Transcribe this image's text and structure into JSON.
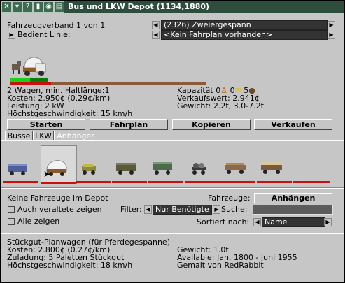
{
  "window": {
    "title": "Bus und LKW Depot (1134,1880)",
    "title_buttons": [
      "close-icon",
      "help-icon",
      "pin-icon",
      "eye-icon",
      "collapse-icon"
    ]
  },
  "convoy": {
    "fahrzeugverband": "Fahrzeugverband 1 von 1",
    "convoy_selected": "(2326) Zweiergespann",
    "bedient_label": "Bedient Linie:",
    "line_selected": "<Kein Fahrplan vorhanden>"
  },
  "stats": {
    "wagen": "2 Wagen, min. Haltlänge:1",
    "kosten": "Kosten:   2.950¢ (0.29¢/km)",
    "leistung": "Leistung:   2 kW",
    "hoechst": "Höchstgeschwindigkeit: 15 km/h",
    "kapazitaet_label": "Kapazität",
    "kapazitaet_values": [
      "0",
      "0",
      "5"
    ],
    "verkaufswert": "Verkaufswert:   2.941¢",
    "gewicht": "Gewicht: 2.2t, 3.0-7.2t"
  },
  "actions": {
    "starten": "Starten",
    "fahrplan": "Fahrplan",
    "kopieren": "Kopieren",
    "verkaufen": "Verkaufen"
  },
  "tabs": [
    "Busse",
    "LKW",
    "Anhänger"
  ],
  "active_tab": 2,
  "depot": {
    "status": "Keine Fahrzeuge im Depot",
    "fahrzeuge_label": "Fahrzeuge:",
    "fahrzeuge_value": "Anhängen",
    "veraltete": "Auch veraltete zeigen",
    "alle": "Alle zeigen",
    "filter_label": "Filter:",
    "filter_value": "Nur Benötigte",
    "suche_label": "Suche:",
    "suche_value": "",
    "sortiert_label": "Sortiert nach:",
    "sortiert_value": "Name"
  },
  "details": {
    "name": "Stückgut-Planwagen (für Pferdegespanne)",
    "kosten": "Kosten:   2.800¢ (0.27¢/km)",
    "zuladung": "Zuladung:   5 Paletten Stückgut",
    "hoechst": "Höchstgeschwindigkeit: 18 km/h",
    "gewicht": "Gewicht:   1.0t",
    "available": "Available: Jan. 1800 - Juni 1955",
    "gemalt": "Gemalt von RedRabbit"
  },
  "colors": {
    "titlebar": "#2f4d3c",
    "window_bg": "#c6c6c6",
    "combo_bg": "#333333",
    "loaded_bar": "#18d018",
    "red_bar": "#c81010"
  }
}
